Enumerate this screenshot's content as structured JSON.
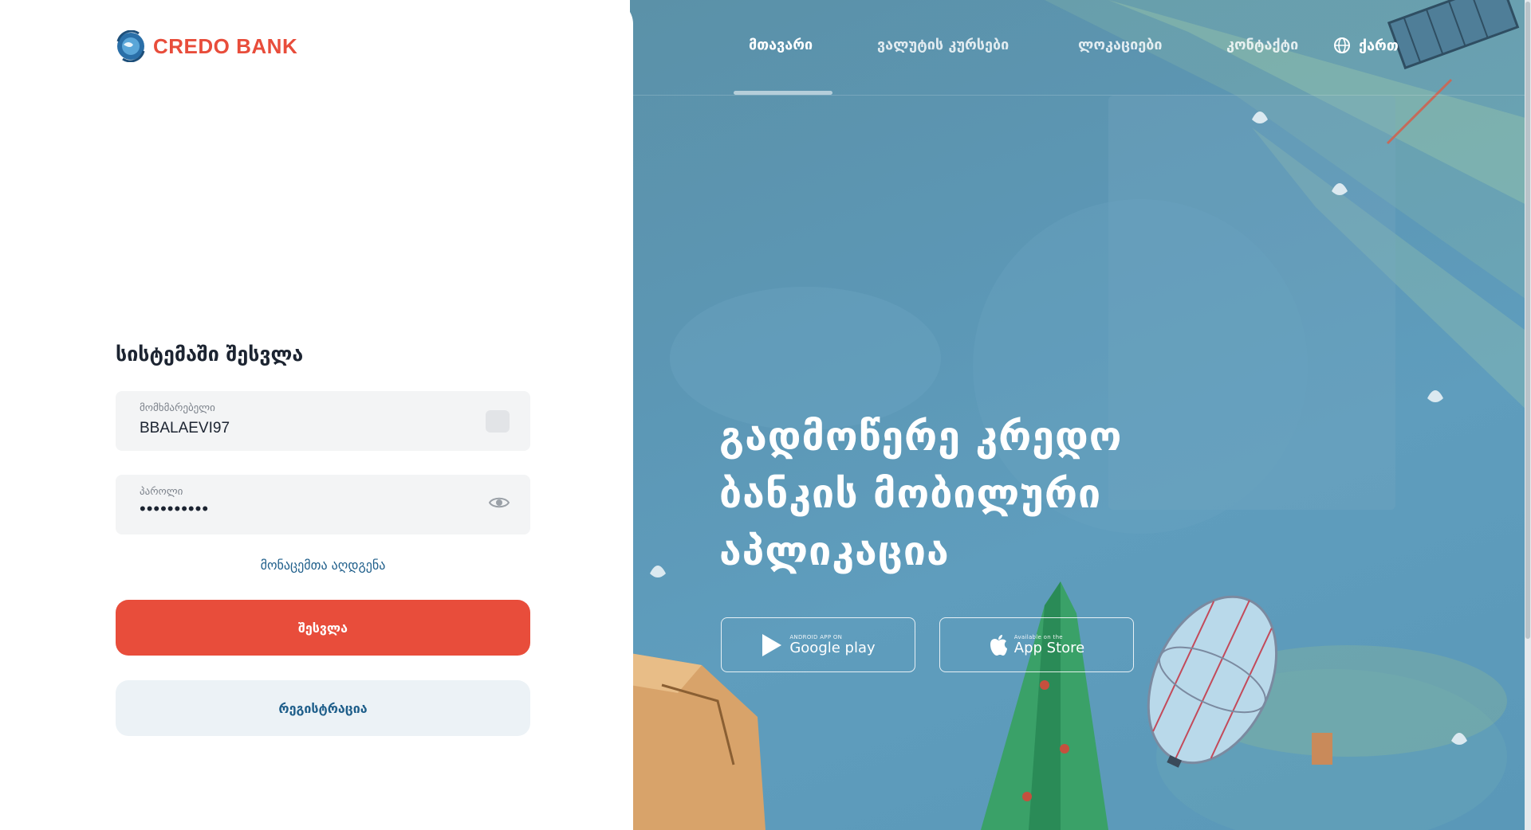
{
  "brand": {
    "name": "CREDO BANK",
    "color": "#e84d3b",
    "logo_icon": "globe-logo-icon"
  },
  "login": {
    "title": "სისტემაში შესვლა",
    "username_label": "მომხმარებელი",
    "username_value": "BBALAEVI97",
    "password_label": "პაროლი",
    "password_value": "••••••••••",
    "recover_link": "მონაცემთა აღდგენა",
    "login_button": "შესვლა",
    "register_button": "რეგისტრაცია"
  },
  "nav": {
    "items": [
      "მთავარი",
      "ვალუტის კურსები",
      "ლოკაციები",
      "კონტაქტი"
    ],
    "active_index": 0,
    "language": "ქართ"
  },
  "hero": {
    "title_lines": [
      "გადმოწერე კრედო",
      "ბანკის მობილური",
      "აპლიკაცია"
    ],
    "google_play_small": "ANDROID APP ON",
    "google_play_big": "Google play",
    "app_store_small": "Available on the",
    "app_store_big": "App Store"
  },
  "colors": {
    "accent": "#e84d3b",
    "link": "#1e5e8a",
    "hero_bg": "#5c97b5"
  }
}
